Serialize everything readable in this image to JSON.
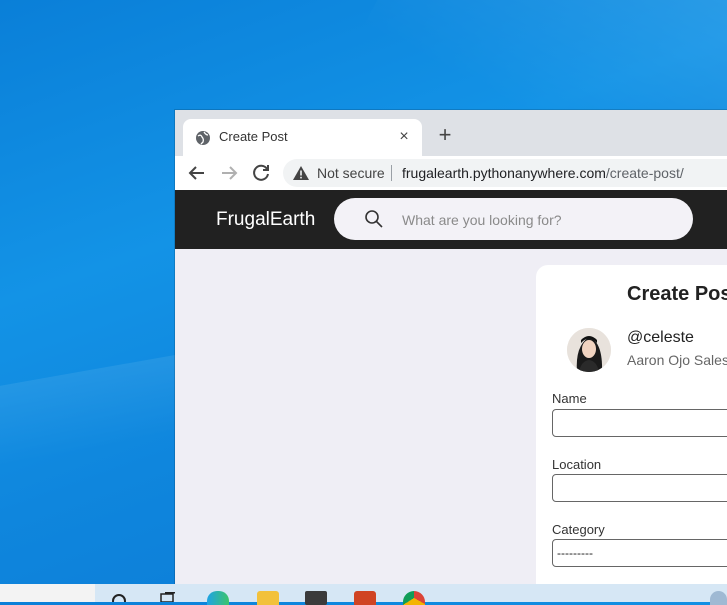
{
  "browser": {
    "tab": {
      "title": "Create Post",
      "close_glyph": "×"
    },
    "new_tab_glyph": "+",
    "omnibox": {
      "security_label": "Not secure",
      "url_host": "frugalearth.pythonanywhere.com",
      "url_path": "/create-post/"
    }
  },
  "site": {
    "brand": "FrugalEarth",
    "search": {
      "placeholder": "What are you looking for?"
    }
  },
  "card": {
    "title": "Create Post",
    "user": {
      "handle": "@celeste",
      "subtitle": "Aaron Ojo Sales"
    },
    "fields": {
      "name_label": "Name",
      "location_label": "Location",
      "category_label": "Category",
      "category_selected": "---------"
    }
  },
  "colors": {
    "site_header": "#212121",
    "page_bg": "#efeef5",
    "desktop": "#0f86dd"
  },
  "taskbar": {
    "icons": [
      "search-icon",
      "task-view-icon",
      "edge-icon",
      "file-explorer-icon",
      "mail-icon",
      "powerpoint-icon",
      "chrome-icon"
    ]
  }
}
